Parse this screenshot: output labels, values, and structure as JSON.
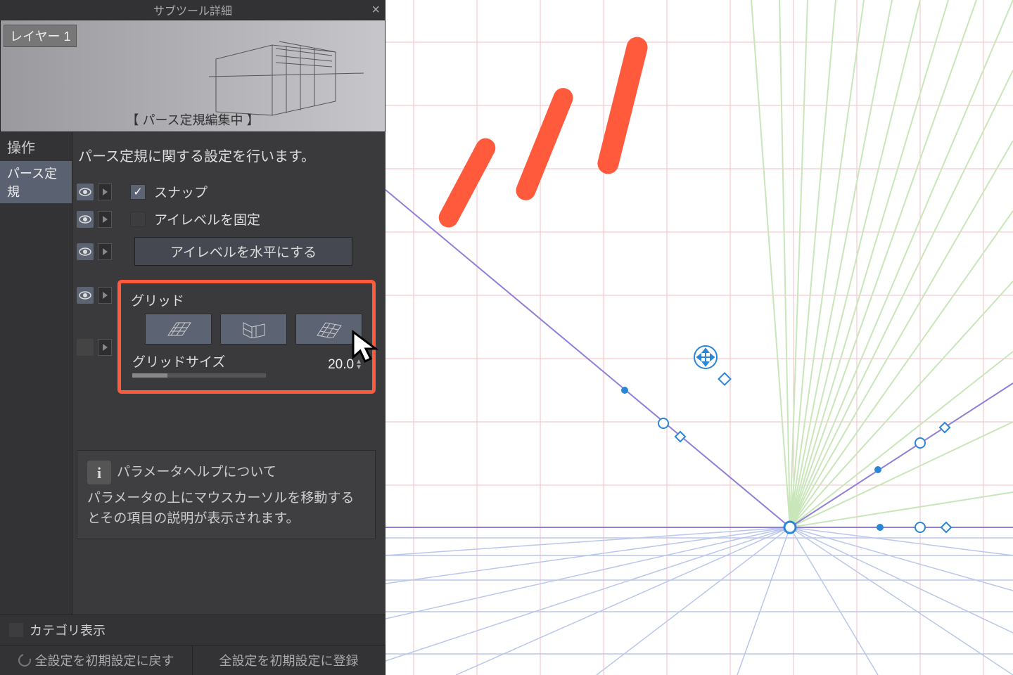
{
  "titlebar": {
    "title": "サブツール詳細"
  },
  "preview": {
    "layer": "レイヤー 1",
    "label": "【 パース定規編集中 】"
  },
  "leftcol": {
    "header": "操作",
    "selected": "パース定規"
  },
  "desc": "パース定規に関する設定を行います。",
  "snap": {
    "label": "スナップ",
    "checked": true
  },
  "eyelevel_fix": {
    "label": "アイレベルを固定",
    "checked": false
  },
  "eyelevel_horiz": {
    "label": "アイレベルを水平にする"
  },
  "grid": {
    "label": "グリッド",
    "size_label": "グリッドサイズ",
    "size_value": "20.0"
  },
  "help": {
    "title": "パラメータヘルプについて",
    "body": "パラメータの上にマウスカーソルを移動するとその項目の説明が表示されます。"
  },
  "footer": {
    "category": "カテゴリ表示",
    "reset": "全設定を初期設定に戻す",
    "register": "全設定を初期設定に登録"
  }
}
